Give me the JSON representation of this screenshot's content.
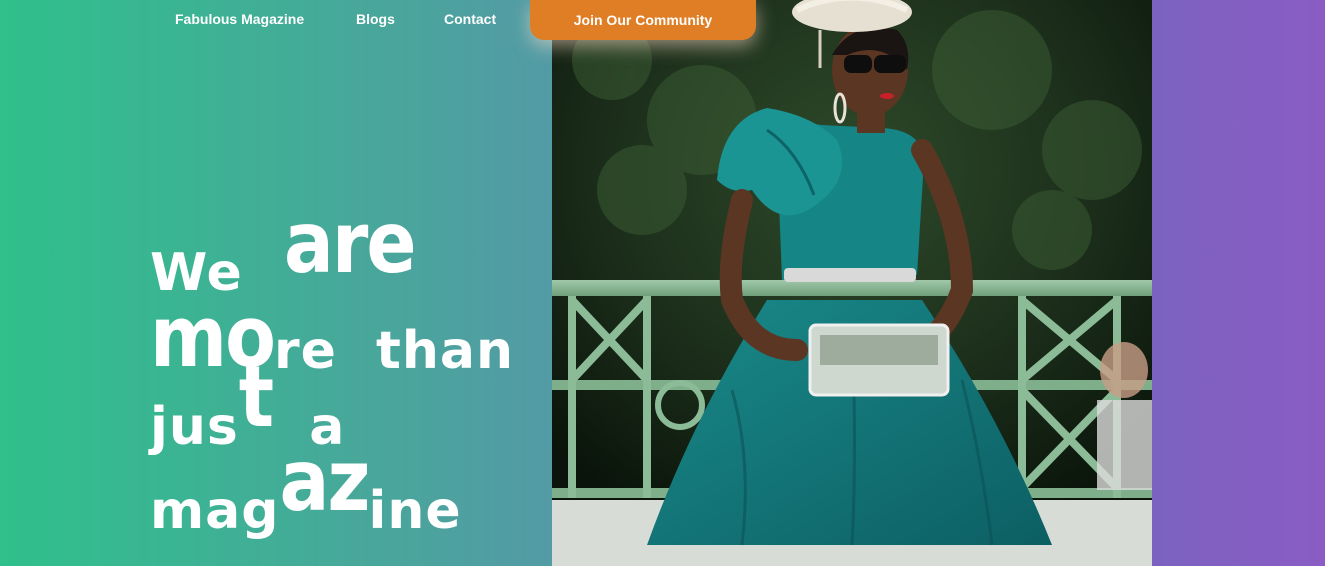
{
  "nav": {
    "links": [
      {
        "label": "Fabulous Magazine"
      },
      {
        "label": "Blogs"
      },
      {
        "label": "Contact"
      }
    ],
    "cta_label": "Join Our Community"
  },
  "hero": {
    "headline_parts": {
      "we": "We",
      "are": "are",
      "more_big": "mo",
      "more_rest": "re",
      "than": "than",
      "jus": "jus",
      "t_big": "t",
      "a": "a",
      "mag": "mag",
      "az_big": "az",
      "ine": "ine"
    }
  },
  "colors": {
    "gradient_start": "#2fc08b",
    "gradient_end": "#8a5cc4",
    "cta": "#df7e24",
    "dress": "#137a7a"
  }
}
